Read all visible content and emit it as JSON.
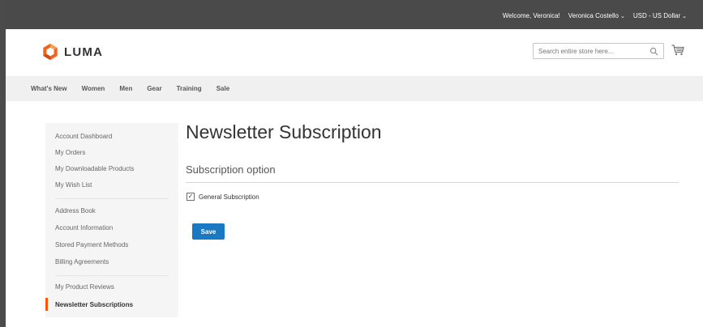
{
  "topbar": {
    "welcome": "Welcome, Veronica!",
    "account": "Veronica Costello",
    "currency": "USD - US Dollar",
    "caret": "⌄"
  },
  "header": {
    "logo_text": "LUMA",
    "search_placeholder": "Search entire store here...",
    "icons": [
      "luma-logo-icon",
      "search-icon",
      "cart-icon"
    ]
  },
  "nav": {
    "items": [
      "What's New",
      "Women",
      "Men",
      "Gear",
      "Training",
      "Sale"
    ]
  },
  "sidebar": {
    "items": [
      "Account Dashboard",
      "My Orders",
      "My Downloadable Products",
      "My Wish List",
      "Address Book",
      "Account Information",
      "Stored Payment Methods",
      "Billing Agreements",
      "My Product Reviews",
      "Newsletter Subscriptions"
    ],
    "active_index": 9
  },
  "main": {
    "title": "Newsletter Subscription",
    "section_title": "Subscription option",
    "checkbox_label": "General Subscription",
    "checkbox_checked": true,
    "save_label": "Save"
  },
  "colors": {
    "topbar_bg": "#4a4a4a",
    "nav_bg": "#f0f0f0",
    "sidebar_bg": "#f5f5f5",
    "accent": "#ff5501",
    "button_bg": "#1979c3"
  }
}
